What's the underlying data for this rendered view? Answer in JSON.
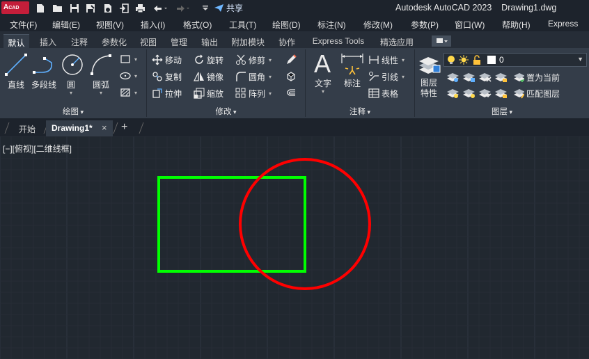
{
  "app": {
    "logo_main": "A",
    "logo_sub": "CAD",
    "title": "Autodesk AutoCAD 2023    Drawing1.dwg",
    "share_label": "共享"
  },
  "menubar": [
    "文件(F)",
    "编辑(E)",
    "视图(V)",
    "插入(I)",
    "格式(O)",
    "工具(T)",
    "绘图(D)",
    "标注(N)",
    "修改(M)",
    "参数(P)",
    "窗口(W)",
    "帮助(H)",
    "Express"
  ],
  "ribbon_tabs": [
    "默认",
    "插入",
    "注释",
    "参数化",
    "视图",
    "管理",
    "输出",
    "附加模块",
    "协作",
    "Express Tools",
    "精选应用"
  ],
  "draw_panel": {
    "title": "绘图",
    "line": "直线",
    "polyline": "多段线",
    "circle": "圆",
    "arc": "圆弧"
  },
  "modify_panel": {
    "title": "修改",
    "move": "移动",
    "rotate": "旋转",
    "trim": "修剪",
    "copy": "复制",
    "mirror": "镜像",
    "fillet": "圆角",
    "stretch": "拉伸",
    "scale": "缩放",
    "array": "阵列"
  },
  "annotation_panel": {
    "title": "注释",
    "text": "文字",
    "dimension": "标注",
    "linear": "线性",
    "leader": "引线",
    "table": "表格"
  },
  "layers_panel": {
    "title": "图层",
    "layer_props_line1": "图层",
    "layer_props_line2": "特性",
    "current_layer": "0",
    "set_current": "置为当前",
    "match_layer": "匹配图层"
  },
  "doc_tabs": {
    "start": "开始",
    "drawing": "Drawing1*",
    "close": "×",
    "add": "+"
  },
  "viewport": {
    "label": "[−][俯视][二维线框]"
  },
  "colors": {
    "rectangle": "#00ff00",
    "circle": "#ff0000",
    "canvas_bg": "#212830",
    "logo_red": "#c41e3a"
  }
}
